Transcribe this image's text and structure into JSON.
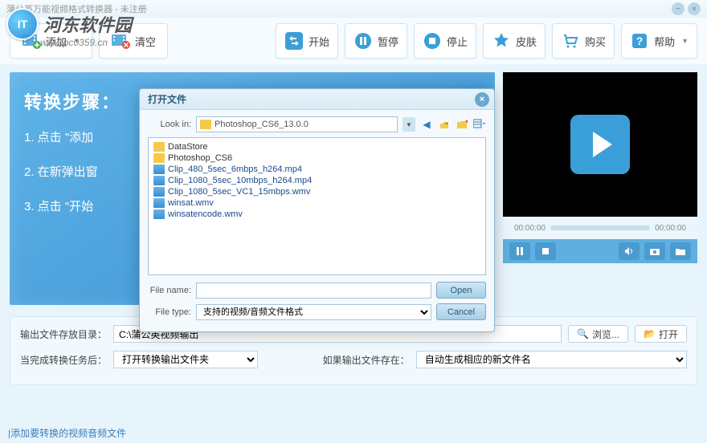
{
  "window": {
    "title": "蒲公英万能视频格式转换器 - 未注册"
  },
  "watermark": {
    "site_name": "河东软件园",
    "url": "www.pc0359.cn",
    "logo_text": "IT"
  },
  "toolbar": {
    "add": "添加",
    "clear": "清空",
    "start": "开始",
    "pause": "暂停",
    "stop": "停止",
    "skin": "皮肤",
    "buy": "购买",
    "help": "帮助"
  },
  "steps": {
    "title": "转换步骤：",
    "s1": "1. 点击 \"添加",
    "s2": "2. 在新弹出窗",
    "s3": "3. 点击 \"开始"
  },
  "preview": {
    "time_start": "00:00:00",
    "time_end": "00:00:00"
  },
  "output": {
    "dir_label": "输出文件存放目录：",
    "dir_value": "C:\\蒲公英视频输出",
    "browse": "浏览...",
    "open": "打开",
    "after_label": "当完成转换任务后：",
    "after_value": "打开转换输出文件夹",
    "exists_label": "如果输出文件存在：",
    "exists_value": "自动生成相应的新文件名"
  },
  "status": "|添加要转换的视频音频文件",
  "dialog": {
    "title": "打开文件",
    "lookin_label": "Look in:",
    "lookin_value": "Photoshop_CS6_13.0.0",
    "files": [
      {
        "name": "DataStore",
        "type": "folder"
      },
      {
        "name": "Photoshop_CS6",
        "type": "folder"
      },
      {
        "name": "Clip_480_5sec_6mbps_h264.mp4",
        "type": "video"
      },
      {
        "name": "Clip_1080_5sec_10mbps_h264.mp4",
        "type": "video"
      },
      {
        "name": "Clip_1080_5sec_VC1_15mbps.wmv",
        "type": "video"
      },
      {
        "name": "winsat.wmv",
        "type": "video"
      },
      {
        "name": "winsatencode.wmv",
        "type": "video"
      }
    ],
    "filename_label": "File name:",
    "filename_value": "",
    "filetype_label": "File type:",
    "filetype_value": "支持的视频/音频文件格式",
    "open_btn": "Open",
    "cancel_btn": "Cancel"
  }
}
